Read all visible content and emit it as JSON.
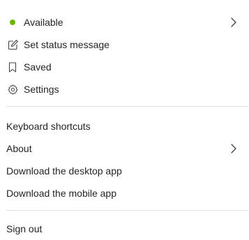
{
  "colors": {
    "available": "#6bb700",
    "divider": "#e1e1e1",
    "text": "#242424",
    "icon": "#424242"
  },
  "status": {
    "label": "Available",
    "icon": "presence-dot-icon"
  },
  "status_message": {
    "label": "Set status message",
    "icon": "edit-note-icon"
  },
  "saved": {
    "label": "Saved",
    "icon": "bookmark-icon"
  },
  "settings": {
    "label": "Settings",
    "icon": "gear-icon"
  },
  "links": {
    "keyboard": "Keyboard shortcuts",
    "about": "About",
    "desktop": "Download the desktop app",
    "mobile": "Download the mobile app"
  },
  "signout": "Sign out"
}
